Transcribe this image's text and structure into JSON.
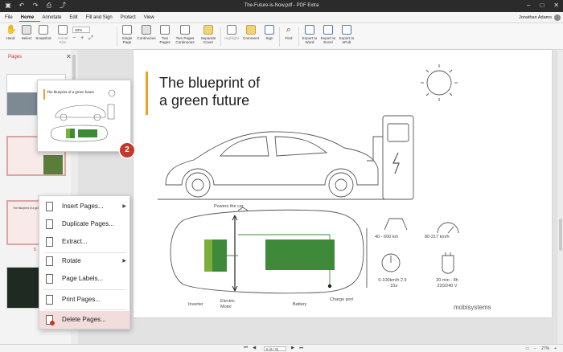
{
  "window": {
    "title": "The-Future-is-Now.pdf - PDF Extra"
  },
  "menubar": {
    "items": [
      "File",
      "Home",
      "Annotate",
      "Edit",
      "Fill and Sign",
      "Protect",
      "View"
    ],
    "active": "Home",
    "user": "Jonathan Adams"
  },
  "ribbon": {
    "hand": "Hand",
    "select": "Select",
    "snapshot": "Snapshot",
    "actual_size": "Actual Size",
    "zoom_value": "33%",
    "single_page": "Single Page",
    "continuous": "Continuous",
    "two_pages": "Two Pages",
    "two_pages_continuous": "Two Pages Continuous",
    "separate_cover": "Separate Cover",
    "highlight": "Highlight",
    "comment": "Comment",
    "sign": "Sign",
    "find": "Find",
    "export_word": "Export to Word",
    "export_excel": "Export to Excel",
    "export_epub": "Export to ePub"
  },
  "pages_panel": {
    "title": "Pages",
    "thumb_title": "The blueprint of a green future",
    "page_numbers": [
      "5",
      "6"
    ]
  },
  "preview": {
    "title": "The blueprint of a green future"
  },
  "badge": {
    "value": "2"
  },
  "context_menu": {
    "items": [
      "Insert Pages...",
      "Duplicate Pages...",
      "Extract...",
      "Rotate",
      "Page Labels...",
      "Print Pages...",
      "Delete Pages..."
    ]
  },
  "page": {
    "headline_line1": "The blueprint of",
    "headline_line2": "a green future",
    "labels": {
      "powers": "Powers the car",
      "inverter": "Inverter",
      "electric_motor": "Electric Motor",
      "battery": "Battery",
      "charge_port": "Charge port",
      "range": "40 - 600 km",
      "speed": "80-217 km/h",
      "accel": "0-100km/h 2.9 - 10s",
      "charge_time": "20 min - 8h 220/240 V"
    },
    "brand": "mobisystems"
  },
  "statusbar": {
    "page_display": "6 (6 / 8)",
    "zoom": "27%"
  },
  "colors": {
    "accent": "#c0392b",
    "orange": "#f0a020",
    "green": "#3f8a3a"
  }
}
